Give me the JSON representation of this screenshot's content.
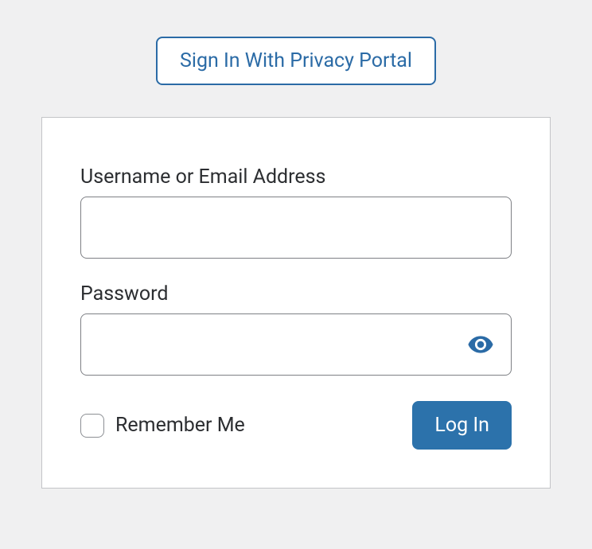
{
  "sso": {
    "button_label": "Sign In With Privacy Portal"
  },
  "form": {
    "username_label": "Username or Email Address",
    "username_value": "",
    "password_label": "Password",
    "password_value": "",
    "remember_label": "Remember Me",
    "submit_label": "Log In"
  },
  "colors": {
    "accent": "#2c72ab",
    "background": "#f0f0f1"
  }
}
